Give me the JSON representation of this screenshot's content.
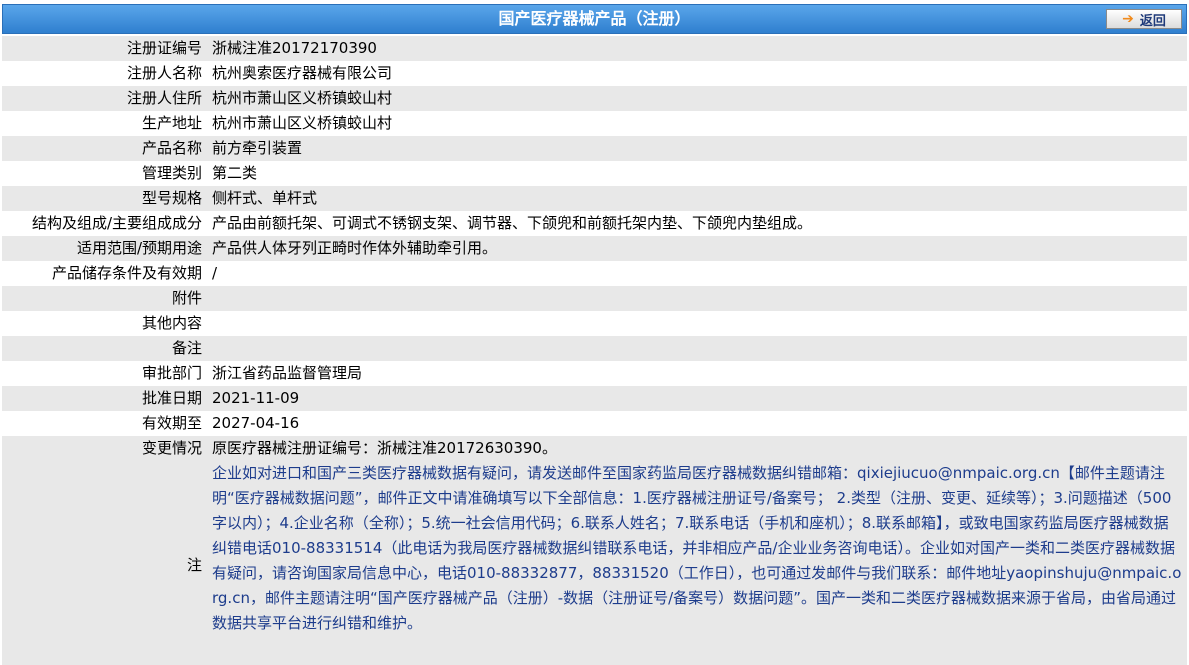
{
  "header": {
    "title": "国产医疗器械产品（注册）",
    "back_label": "返回",
    "back_icon": "arrow-right-icon"
  },
  "rows": [
    {
      "label": "注册证编号",
      "value": "浙械注准20172170390"
    },
    {
      "label": "注册人名称",
      "value": "杭州奥索医疗器械有限公司"
    },
    {
      "label": "注册人住所",
      "value": "杭州市萧山区义桥镇蛟山村"
    },
    {
      "label": "生产地址",
      "value": "杭州市萧山区义桥镇蛟山村"
    },
    {
      "label": "产品名称",
      "value": "前方牵引装置"
    },
    {
      "label": "管理类别",
      "value": "第二类"
    },
    {
      "label": "型号规格",
      "value": "侧杆式、单杆式"
    },
    {
      "label": "结构及组成/主要组成成分",
      "value": "产品由前额托架、可调式不锈钢支架、调节器、下颌兜和前额托架内垫、下颌兜内垫组成。"
    },
    {
      "label": "适用范围/预期用途",
      "value": "产品供人体牙列正畸时作体外辅助牵引用。"
    },
    {
      "label": "产品储存条件及有效期",
      "value": "/"
    },
    {
      "label": "附件",
      "value": ""
    },
    {
      "label": "其他内容",
      "value": ""
    },
    {
      "label": "备注",
      "value": ""
    },
    {
      "label": "审批部门",
      "value": "浙江省药品监督管理局"
    },
    {
      "label": "批准日期",
      "value": "2021-11-09"
    },
    {
      "label": "有效期至",
      "value": "2027-04-16"
    },
    {
      "label": "变更情况",
      "value": "原医疗器械注册证编号：浙械注准20172630390。"
    }
  ],
  "note": {
    "label": "注",
    "text": "企业如对进口和国产三类医疗器械数据有疑问，请发送邮件至国家药监局医疗器械数据纠错邮箱：qixiejiucuo@nmpaic.org.cn【邮件主题请注明“医疗器械数据问题”，邮件正文中请准确填写以下全部信息：1.医疗器械注册证号/备案号； 2.类型（注册、变更、延续等）；3.问题描述（500字以内）；4.企业名称（全称）；5.统一社会信用代码；6.联系人姓名；7.联系电话（手机和座机）；8.联系邮箱】，或致电国家药监局医疗器械数据纠错电话010-88331514（此电话为我局医疗器械数据纠错联系电话，并非相应产品/企业业务咨询电话）。企业如对国产一类和二类医疗器械数据有疑问，请咨询国家局信息中心，电话010-88332877，88331520（工作日），也可通过发邮件与我们联系：邮件地址yaopinshuju@nmpaic.org.cn，邮件主题请注明“国产医疗器械产品（注册）-数据（注册证号/备案号）数据问题”。国产一类和二类医疗器械数据来源于省局，由省局通过数据共享平台进行纠错和维护。"
  },
  "colors": {
    "header_bg": "#2f7fcf",
    "row_gray": "#e8e8e8",
    "note_text": "#1d3c8c",
    "back_icon": "#f08a1c"
  }
}
